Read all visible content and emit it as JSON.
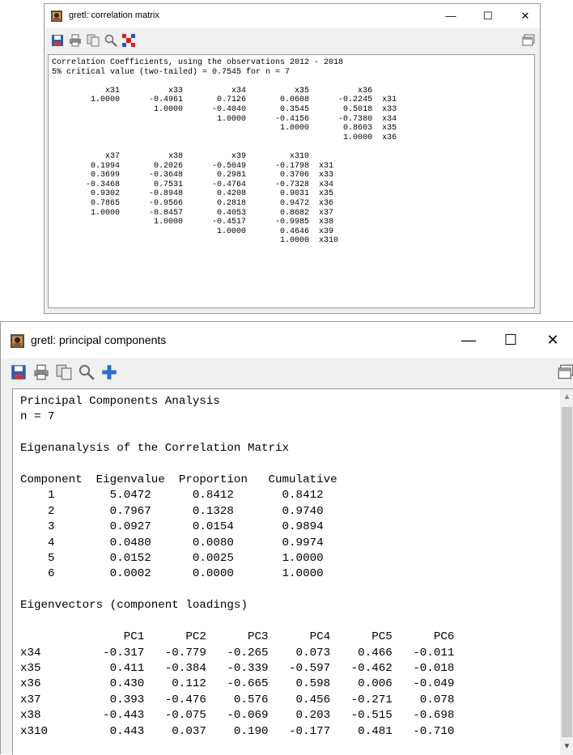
{
  "correlation_window": {
    "title": "gretl: correlation matrix",
    "controls": {
      "minimize": "—",
      "maximize": "☐",
      "close": "✕"
    },
    "toolbar": [
      "save-icon",
      "print-icon",
      "copy-icon",
      "find-icon",
      "heatmap-icon"
    ],
    "text": "Correlation Coefficients, using the observations 2012 - 2018\n5% critical value (two-tailed) = 0.7545 for n = 7\n\n           x31          x33          x34          x35          x36\n        1.0000      -0.4961       0.7126       0.0608      -0.2245  x31\n                     1.0000      -0.4040       0.3545       0.5018  x33\n                                  1.0000      -0.4156      -0.7380  x34\n                                               1.0000       0.8603  x35\n                                                            1.0000  x36\n\n           x37          x38          x39         x310\n        0.1994       0.2026      -0.5049      -0.1798  x31\n        0.3699      -0.3648       0.2981       0.3706  x33\n       -0.3468       0.7531      -0.4764      -0.7328  x34\n        0.9302      -0.8948       0.4208       0.9031  x35\n        0.7865      -0.9566       0.2818       0.9472  x36\n        1.0000      -0.8457       0.4053       0.8682  x37\n                     1.0000      -0.4517      -0.9985  x38\n                                  1.0000       0.4646  x39\n                                               1.0000  x310"
  },
  "pca_window": {
    "title": "gretl: principal components",
    "controls": {
      "minimize": "—",
      "maximize": "☐",
      "close": "✕"
    },
    "toolbar": [
      "save-icon",
      "print-icon",
      "copy-icon",
      "find-icon",
      "add-icon"
    ],
    "text": "Principal Components Analysis\nn = 7\n\nEigenanalysis of the Correlation Matrix\n\nComponent  Eigenvalue  Proportion   Cumulative\n    1        5.0472      0.8412       0.8412\n    2        0.7967      0.1328       0.9740\n    3        0.0927      0.0154       0.9894\n    4        0.0480      0.0080       0.9974\n    5        0.0152      0.0025       1.0000\n    6        0.0002      0.0000       1.0000\n\nEigenvectors (component loadings)\n\n               PC1      PC2      PC3      PC4      PC5      PC6\nx34         -0.317   -0.779   -0.265    0.073    0.466   -0.011\nx35          0.411   -0.384   -0.339   -0.597   -0.462   -0.018\nx36          0.430    0.112   -0.665    0.598    0.006   -0.049\nx37          0.393   -0.476    0.576    0.456   -0.271    0.078\nx38         -0.443   -0.075   -0.069    0.203   -0.515   -0.698\nx310         0.443    0.037    0.190   -0.177    0.481   -0.710"
  }
}
